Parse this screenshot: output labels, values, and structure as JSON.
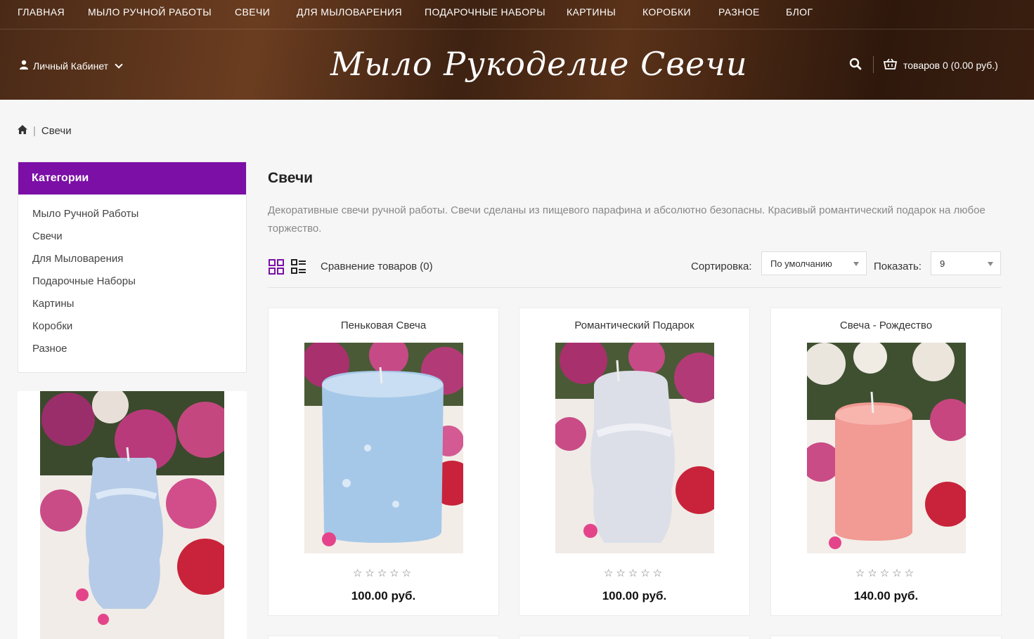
{
  "nav": {
    "items": [
      "ГЛАВНАЯ",
      "МЫЛО РУЧНОЙ РАБОТЫ",
      "СВЕЧИ",
      "ДЛЯ МЫЛОВАРЕНИЯ",
      "ПОДАРОЧНЫЕ НАБОРЫ",
      "КАРТИНЫ",
      "КОРОБКИ",
      "РАЗНОЕ",
      "БЛОГ"
    ]
  },
  "header": {
    "account_label": "Личный Кабинет",
    "logo_text": "Мыло Рукоделие Свечи",
    "cart_label": "товаров 0 (0.00 руб.)",
    "icons": {
      "account": "user-icon",
      "search": "search-icon",
      "cart": "basket-icon"
    }
  },
  "breadcrumb": {
    "current": "Свечи"
  },
  "sidebar": {
    "title": "Категории",
    "categories": [
      "Мыло Ручной Работы",
      "Свечи",
      "Для Мыловарения",
      "Подарочные Наборы",
      "Картины",
      "Коробки",
      "Разное"
    ]
  },
  "main": {
    "title": "Свечи",
    "description": "Декоративные свечи ручной работы. Свечи сделаны из пищевого парафина и абсолютно безопасны. Красивый романтический подарок на любое торжество.",
    "compare_label": "Сравнение товаров (0)",
    "sort_label": "Сортировка:",
    "sort_value": "По умолчанию",
    "limit_label": "Показать:",
    "limit_value": "9"
  },
  "products": [
    {
      "name": "Пеньковая Свеча",
      "price": "100.00 руб.",
      "rating": "☆☆☆☆☆",
      "color": "#a9cbe6"
    },
    {
      "name": "Романтический Подарок",
      "price": "100.00 руб.",
      "rating": "☆☆☆☆☆",
      "color": "#d9dde6"
    },
    {
      "name": "Свеча - Рождество",
      "price": "140.00 руб.",
      "rating": "☆☆☆☆☆",
      "color": "#f2a09a"
    }
  ],
  "colors": {
    "accent": "#7b0fa6",
    "header_bg": "#4a2a17"
  }
}
